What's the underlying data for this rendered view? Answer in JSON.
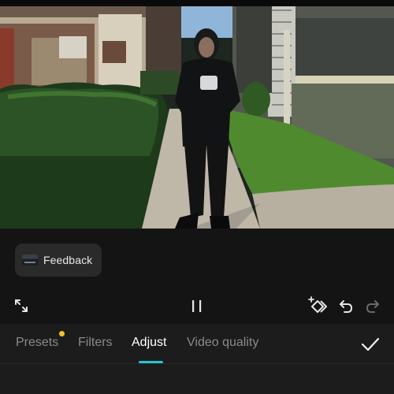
{
  "feedback": {
    "label": "Feedback",
    "thumbnail": "video-thumbnail"
  },
  "controls": {
    "fullscreen_icon": "fullscreen-icon",
    "pause_icon": "pause-icon",
    "keyframe_icon": "keyframe-add-icon",
    "undo_icon": "undo-icon",
    "redo_icon": "redo-icon",
    "redo_enabled": false
  },
  "tabs": [
    {
      "label": "Presets",
      "active": false,
      "has_badge": true
    },
    {
      "label": "Filters",
      "active": false
    },
    {
      "label": "Adjust",
      "active": true
    },
    {
      "label": "Video quality",
      "active": false
    }
  ],
  "confirm_icon": "checkmark-icon",
  "colors": {
    "accent": "#26c5d3",
    "badge": "#f5c32a",
    "background": "#141414",
    "tabbar": "#1c1c1c"
  }
}
